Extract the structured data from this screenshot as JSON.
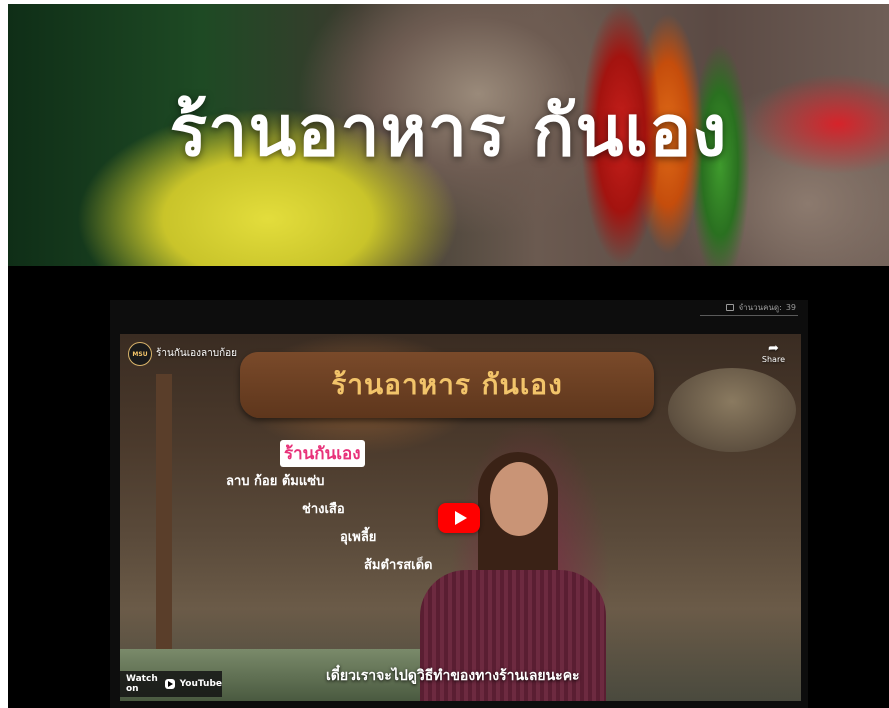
{
  "hero": {
    "title": "ร้านอาหาร กันเอง"
  },
  "counter": {
    "icon": "viewer-icon",
    "label": "จำนวนคนดู:",
    "value": "39"
  },
  "video": {
    "channel_logo_text": "MSU",
    "title": "ร้านกันเองลาบก้อย",
    "share_label": "Share",
    "watch_on_label": "Watch on",
    "youtube_label": "YouTube",
    "caption": "เดี๋ยวเราจะไปดูวิธีทำของทางร้านเลยนะคะ",
    "scene": {
      "sign_text": "ร้านอาหาร กันเอง",
      "board_title": "ร้านกันเอง",
      "board_lines": [
        "ลาบ ก้อย ต้มแซ่บ",
        "ช่างเสือ",
        "อุเพลี้ย",
        "ส้มตำรสเด็ด"
      ]
    }
  },
  "colors": {
    "play_button": "#ff0000",
    "background": "#000000"
  }
}
